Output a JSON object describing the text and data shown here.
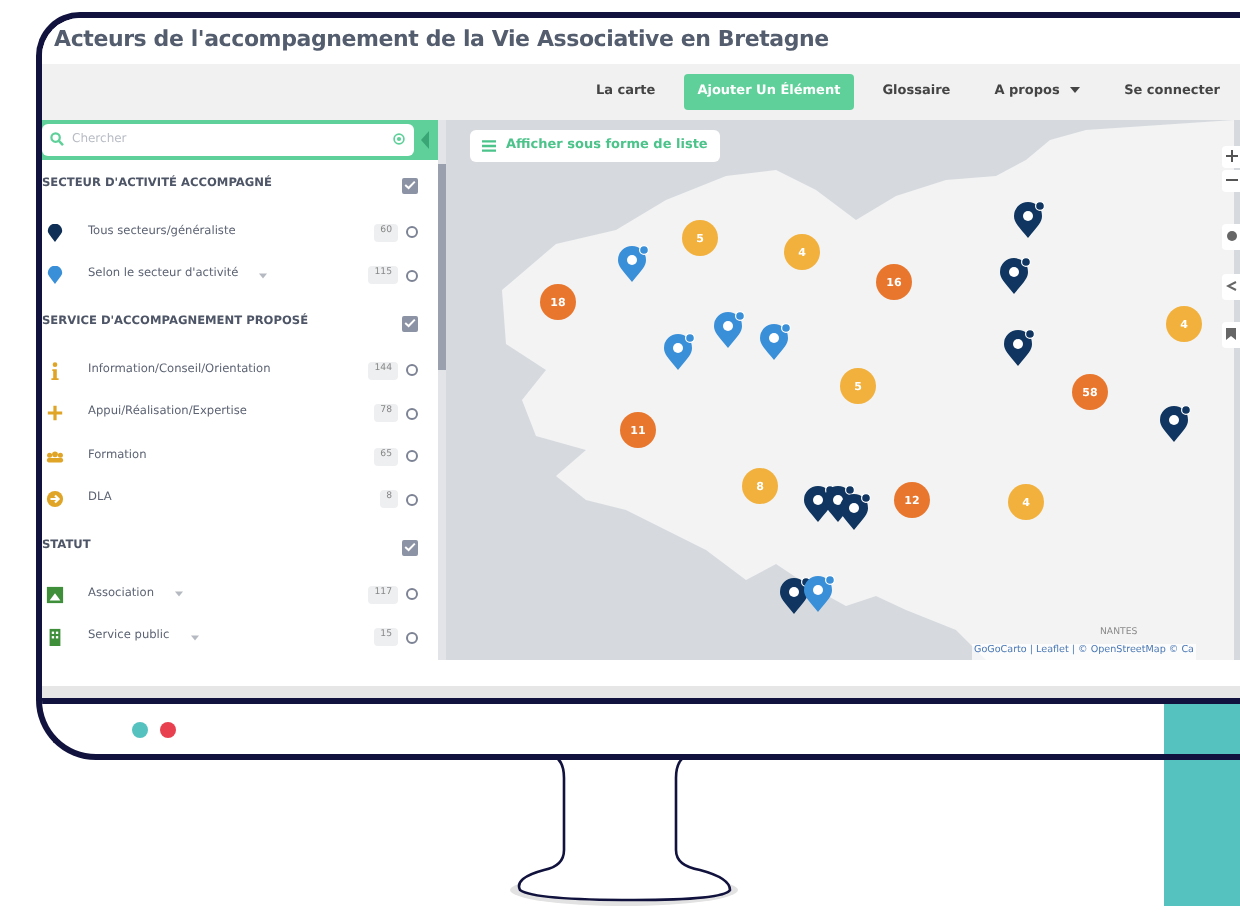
{
  "page_title": "Acteurs de l'accompagnement de la Vie Associative en Bretagne",
  "nav": [
    {
      "label": "La carte",
      "kind": "link"
    },
    {
      "label": "Ajouter Un Élément",
      "kind": "button"
    },
    {
      "label": "Glossaire",
      "kind": "link"
    },
    {
      "label": "A propos",
      "kind": "dropdown"
    },
    {
      "label": "Se connecter",
      "kind": "link"
    }
  ],
  "search": {
    "placeholder": "Chercher"
  },
  "sections": [
    {
      "title": "SECTEUR D'ACTIVITÉ ACCOMPAGNÉ",
      "checked": true,
      "items": [
        {
          "label": "Tous secteurs/généraliste",
          "count": "60",
          "color": "#0f2f57",
          "expandable": false,
          "selected": false
        },
        {
          "label": "Selon le secteur d'activité",
          "count": "115",
          "color": "#3a8fd9",
          "expandable": true,
          "selected": false
        }
      ]
    },
    {
      "title": "SERVICE D'ACCOMPAGNEMENT PROPOSÉ",
      "checked": true,
      "items": [
        {
          "label": "Information/Conseil/Orientation",
          "count": "144",
          "color": "#e0a526",
          "expandable": false,
          "selected": false
        },
        {
          "label": "Appui/Réalisation/Expertise",
          "count": "78",
          "color": "#e0a526",
          "expandable": false,
          "selected": false
        },
        {
          "label": "Formation",
          "count": "65",
          "color": "#e0a526",
          "expandable": false,
          "selected": false
        },
        {
          "label": "DLA",
          "count": "8",
          "color": "#e0a526",
          "expandable": false,
          "selected": false
        }
      ]
    },
    {
      "title": "STATUT",
      "checked": true,
      "items": [
        {
          "label": "Association",
          "count": "117",
          "color": "#3f8f3a",
          "expandable": true,
          "selected": false
        },
        {
          "label": "Service public",
          "count": "15",
          "color": "#3f8f3a",
          "expandable": true,
          "selected": false
        }
      ]
    }
  ],
  "map": {
    "list_button": "Afficher sous forme de liste",
    "city_label": "NANTES",
    "attribution": "GoGoCarto | Leaflet | © OpenStreetMap © Ca",
    "clusters": [
      {
        "count": "5",
        "color": "#f2b03c"
      },
      {
        "count": "4",
        "color": "#f2b03c"
      },
      {
        "count": "16",
        "color": "#e8762d"
      },
      {
        "count": "18",
        "color": "#e8762d"
      },
      {
        "count": "4",
        "color": "#f2b03c"
      },
      {
        "count": "5",
        "color": "#f2b03c"
      },
      {
        "count": "58",
        "color": "#e8762d"
      },
      {
        "count": "11",
        "color": "#e8762d"
      },
      {
        "count": "8",
        "color": "#f2b03c"
      },
      {
        "count": "12",
        "color": "#e8762d"
      },
      {
        "count": "4",
        "color": "#f2b03c"
      }
    ],
    "pins": [
      {
        "color": "#3a8fd9"
      },
      {
        "color": "#3a8fd9"
      },
      {
        "color": "#3a8fd9"
      },
      {
        "color": "#3a8fd9"
      },
      {
        "color": "#0f3560"
      },
      {
        "color": "#0f3560"
      },
      {
        "color": "#0f3560"
      },
      {
        "color": "#0f3560"
      },
      {
        "color": "#0f3560"
      },
      {
        "color": "#0f3560"
      },
      {
        "color": "#0f3560"
      },
      {
        "color": "#0f3560"
      },
      {
        "color": "#3a8fd9"
      }
    ]
  }
}
